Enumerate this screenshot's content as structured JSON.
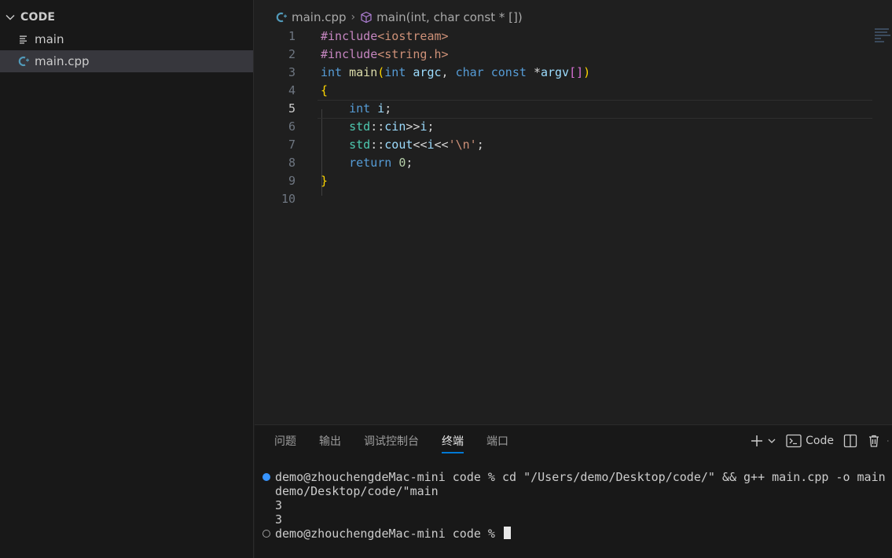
{
  "sidebar": {
    "folder": "CODE",
    "items": [
      {
        "label": "main",
        "icon": "lines-file-icon"
      },
      {
        "label": "main.cpp",
        "icon": "cpp-file-icon"
      }
    ]
  },
  "breadcrumb": {
    "file": "main.cpp",
    "symbol": "main(int, char const * [])"
  },
  "editor": {
    "line_numbers": [
      "1",
      "2",
      "3",
      "4",
      "5",
      "6",
      "7",
      "8",
      "9",
      "10"
    ],
    "current_line": "5",
    "code_lines": [
      "#include<iostream>",
      "#include<string.h>",
      "int main(int argc, char const *argv[])",
      "{",
      "    int i;",
      "    std::cin>>i;",
      "    std::cout<<i<<'\\n';",
      "    return 0;",
      "}",
      ""
    ]
  },
  "panel": {
    "tabs": [
      {
        "label": "问题",
        "active": false
      },
      {
        "label": "输出",
        "active": false
      },
      {
        "label": "调试控制台",
        "active": false
      },
      {
        "label": "终端",
        "active": true
      },
      {
        "label": "端口",
        "active": false
      }
    ],
    "terminal_name": "Code",
    "lines": [
      "demo@zhouchengdeMac-mini code % cd \"/Users/demo/Desktop/code/\" && g++ main.cpp -o main && \"/Users/",
      "demo/Desktop/code/\"main",
      "3",
      "3",
      "demo@zhouchengdeMac-mini code % "
    ]
  },
  "colors": {
    "accent": "#0078d4",
    "keyword": "#569cd6",
    "preprocessor": "#c586c0",
    "string": "#ce9178",
    "function": "#dcdcaa",
    "variable": "#9cdcfe",
    "type": "#4ec9b0",
    "number": "#b5cea8"
  }
}
